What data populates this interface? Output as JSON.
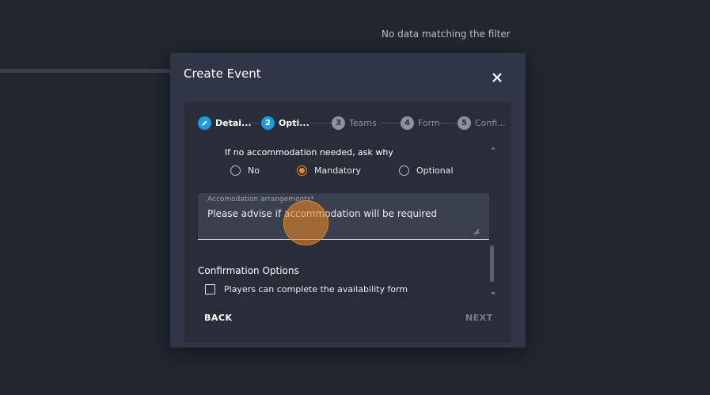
{
  "background": {
    "empty_message": "No data matching the filter"
  },
  "dialog": {
    "title": "Create Event",
    "close_icon": "close-icon"
  },
  "stepper": {
    "steps": [
      {
        "number": "",
        "icon": "pencil-icon",
        "label": "Detai...",
        "state": "completed"
      },
      {
        "number": "2",
        "label": "Opti...",
        "state": "active"
      },
      {
        "number": "3",
        "label": "Teams",
        "state": "inactive"
      },
      {
        "number": "4",
        "label": "Form",
        "state": "inactive"
      },
      {
        "number": "5",
        "label": "Confi...",
        "state": "inactive"
      }
    ]
  },
  "accommodation": {
    "question": "If no accommodation needed, ask why",
    "options": [
      "No",
      "Mandatory",
      "Optional"
    ],
    "selected": "Mandatory",
    "field_label": "Accomodation arrangements*",
    "field_value": "Please advise if accommodation will be required"
  },
  "confirmation": {
    "section_title": "Confirmation Options",
    "checkbox_label": "Players can complete the availability form",
    "checked": false
  },
  "actions": {
    "back_label": "BACK",
    "next_label": "NEXT"
  },
  "colors": {
    "accent_active": "#1e9be0",
    "radio_selected": "#f08a24",
    "dialog_bg": "#303646",
    "page_bg": "#222630"
  }
}
